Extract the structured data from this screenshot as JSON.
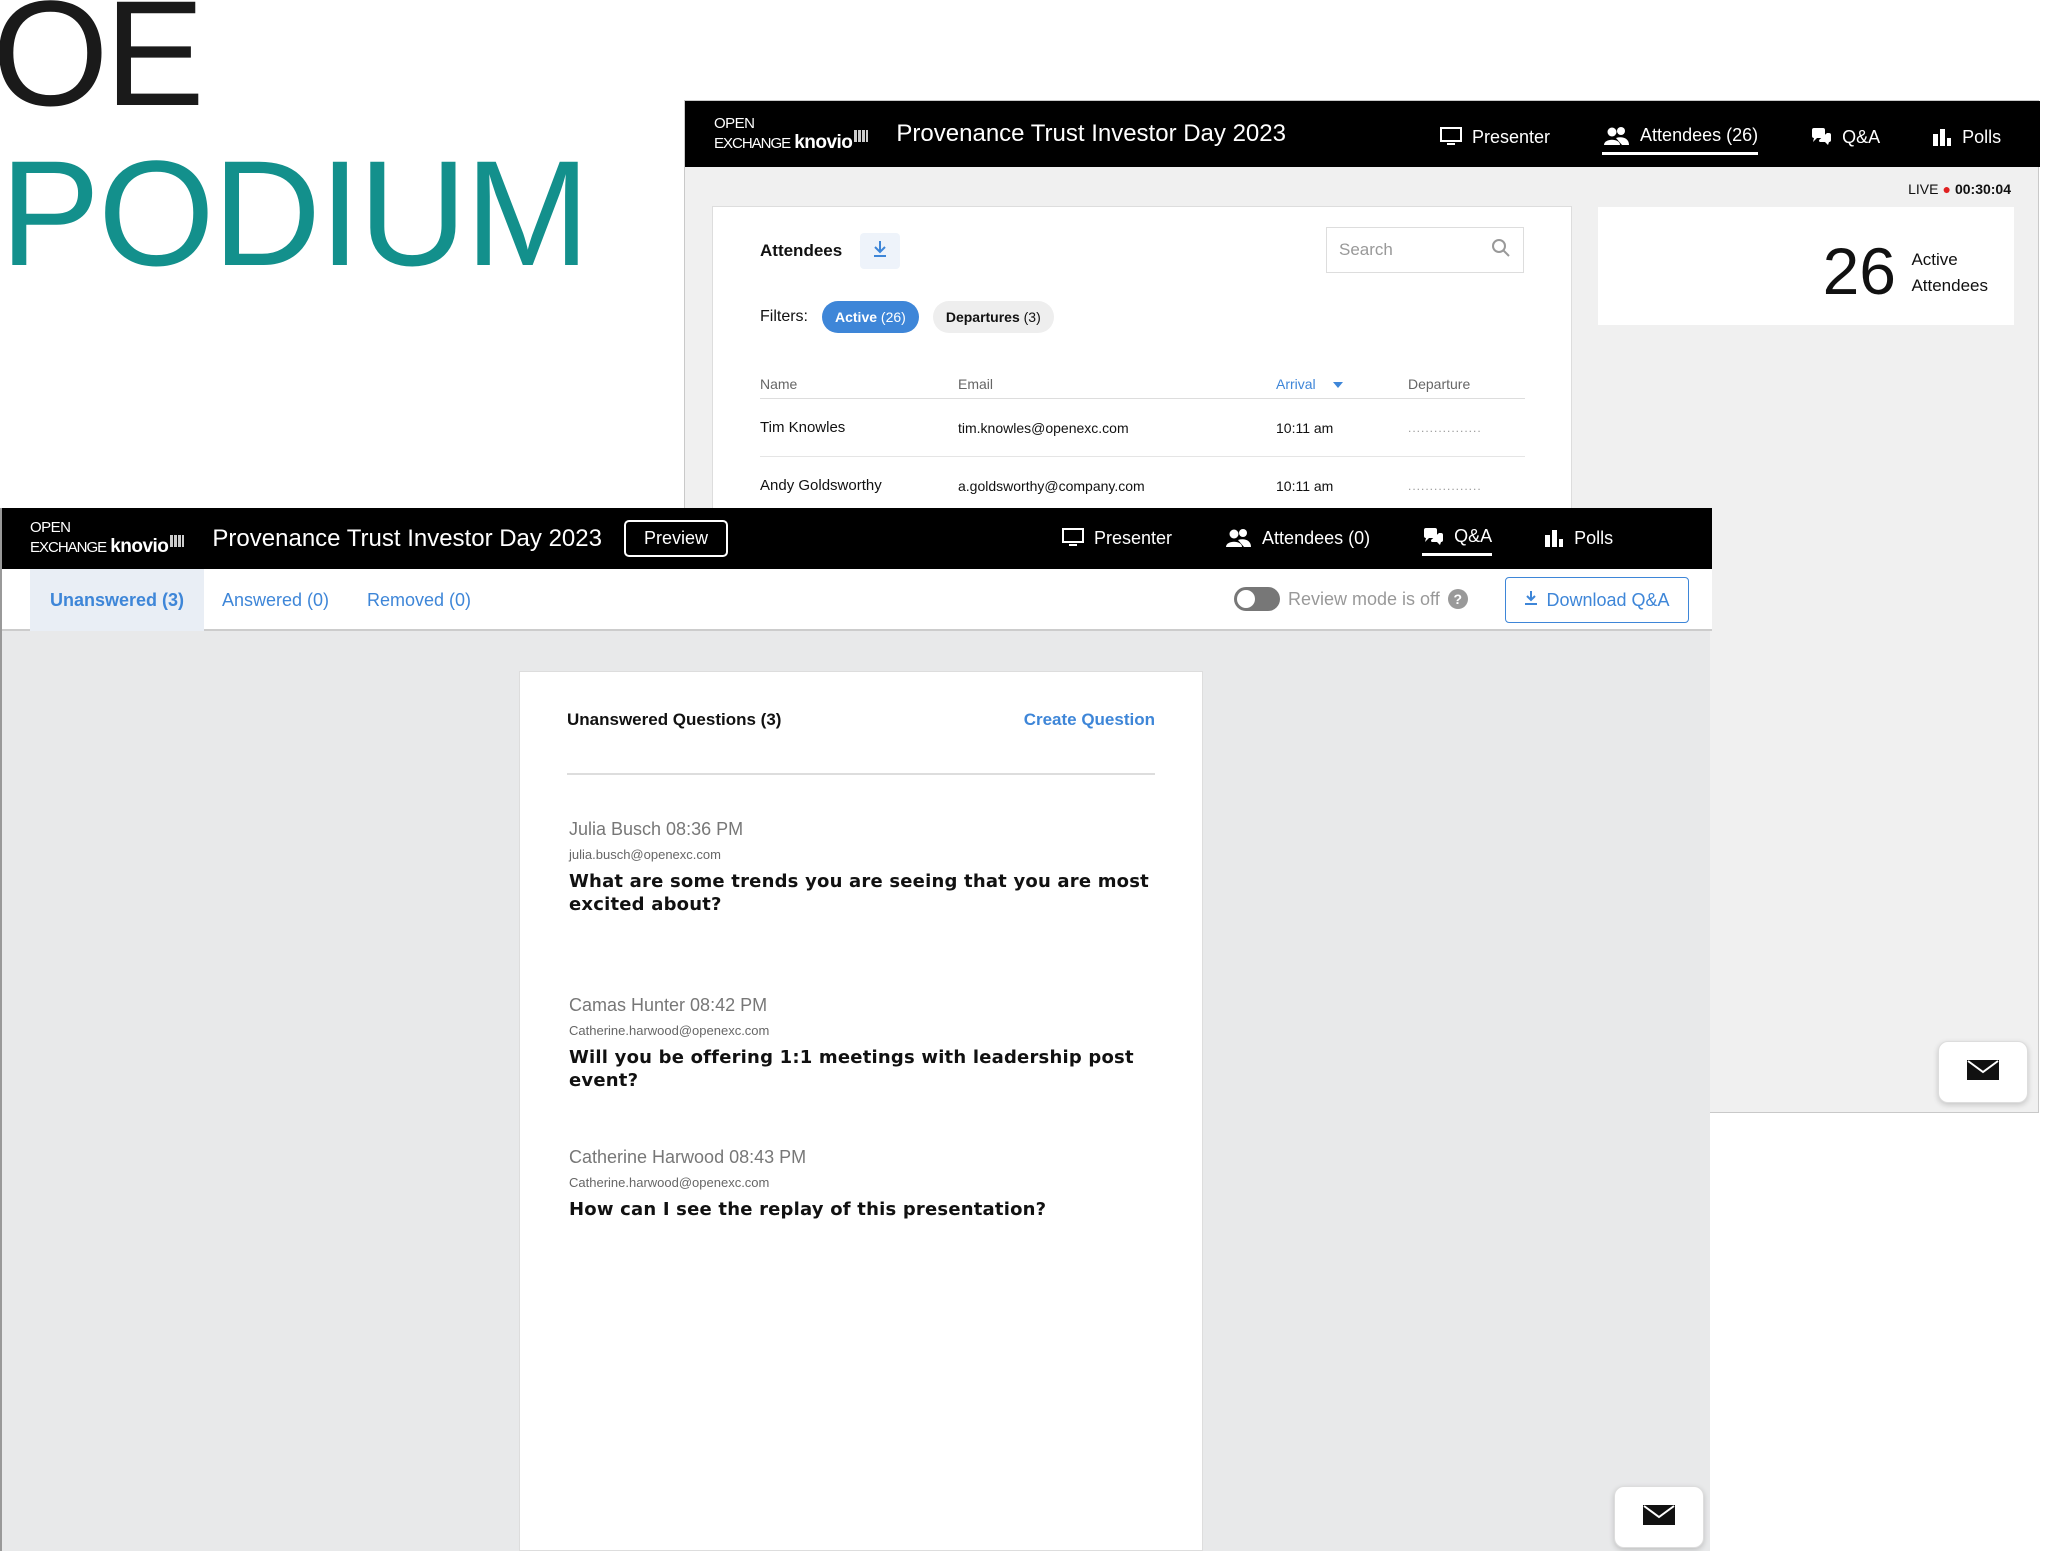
{
  "brand": {
    "line1": "OE",
    "line2": "PODIUM",
    "accent_color": "#13908c"
  },
  "logo": {
    "open": "OPEN",
    "exchange": "EXCHANGE",
    "knovio": "knovio"
  },
  "back_window": {
    "event_title": "Provenance Trust Investor Day 2023",
    "nav": [
      {
        "label": "Presenter",
        "icon": "monitor-icon"
      },
      {
        "label": "Attendees (26)",
        "icon": "people-icon",
        "active": true
      },
      {
        "label": "Q&A",
        "icon": "chat-icon"
      },
      {
        "label": "Polls",
        "icon": "bar-chart-icon"
      }
    ],
    "live": {
      "label": "LIVE",
      "time": "00:30:04"
    },
    "attendees": {
      "title": "Attendees",
      "search_placeholder": "Search",
      "filters_label": "Filters:",
      "filter_active": {
        "label": "Active",
        "count": "(26)"
      },
      "filter_departures": {
        "label": "Departures",
        "count": "(3)"
      },
      "columns": [
        "Name",
        "Email",
        "Arrival",
        "Departure"
      ],
      "rows": [
        {
          "name": "Tim Knowles",
          "email": "tim.knowles@openexc.com",
          "arrival": "10:11 am",
          "departure": "................."
        },
        {
          "name": "Andy Goldsworthy",
          "email": "a.goldsworthy@company.com",
          "arrival": "10:11 am",
          "departure": "................."
        }
      ]
    },
    "active_count": {
      "number": "26",
      "label_line1": "Active",
      "label_line2": "Attendees"
    }
  },
  "front_window": {
    "event_title": "Provenance Trust Investor Day 2023",
    "preview_label": "Preview",
    "nav": [
      {
        "label": "Presenter",
        "icon": "monitor-icon"
      },
      {
        "label": "Attendees (0)",
        "icon": "people-icon"
      },
      {
        "label": "Q&A",
        "icon": "chat-icon",
        "active": true
      },
      {
        "label": "Polls",
        "icon": "bar-chart-icon"
      }
    ],
    "tabs": [
      {
        "label": "Unanswered (3)",
        "active": true
      },
      {
        "label": "Answered (0)"
      },
      {
        "label": "Removed (0)"
      }
    ],
    "review_mode": {
      "label": "Review mode is off",
      "enabled": false,
      "help": "?"
    },
    "download_label": "Download Q&A",
    "qa": {
      "title": "Unanswered Questions (3)",
      "create_label": "Create Question",
      "questions": [
        {
          "author": "Julia Busch 08:36 PM",
          "email": "julia.busch@openexc.com",
          "text": "What are some trends you are seeing that you are most excited about?"
        },
        {
          "author": "Camas Hunter 08:42 PM",
          "email": "Catherine.harwood@openexc.com",
          "text": "Will you be offering 1:1 meetings with leadership post event?"
        },
        {
          "author": "Catherine Harwood 08:43 PM",
          "email": "Catherine.harwood@openexc.com",
          "text": "How can I see the replay of this presentation?"
        }
      ]
    }
  },
  "colors": {
    "accent_blue": "#3e86d8",
    "live_dot": "#e02020",
    "topbar": "#000000"
  }
}
